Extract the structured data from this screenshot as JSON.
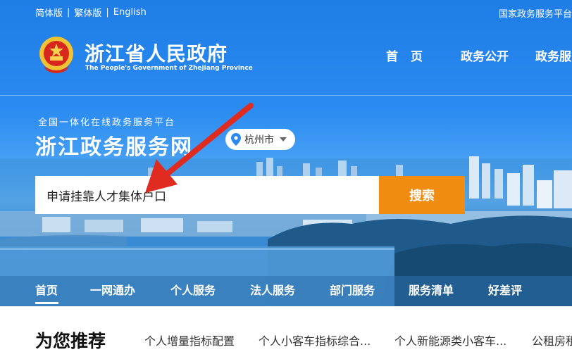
{
  "colors": {
    "hero_blue": "#2a8af0",
    "search_button": "#f08c0f",
    "text_white": "#ffffff"
  },
  "top_bar": {
    "languages": [
      "简体版",
      "繁体版",
      "English"
    ],
    "right_link": "国家政务服务平台"
  },
  "brand": {
    "emblem_icon": "national-emblem-icon",
    "title_cn": "浙江省人民政府",
    "title_en": "The People's Government of Zhejiang Province"
  },
  "main_nav": [
    "首页",
    "政务公开",
    "政务服"
  ],
  "platform": {
    "subtitle": "全国一体化在线政务服务平台",
    "title": "浙江政务服务网",
    "city": "杭州市"
  },
  "search": {
    "value": "申请挂靠人才集体户口",
    "button_label": "搜索"
  },
  "sub_nav": [
    "首页",
    "一网通办",
    "个人服务",
    "法人服务",
    "部门服务",
    "服务清单",
    "好差评"
  ],
  "recommend": {
    "title": "为您推荐",
    "items": [
      "个人增量指标配置",
      "个人小客车指标综合...",
      "个人新能源类小客车...",
      "公租房租"
    ]
  }
}
